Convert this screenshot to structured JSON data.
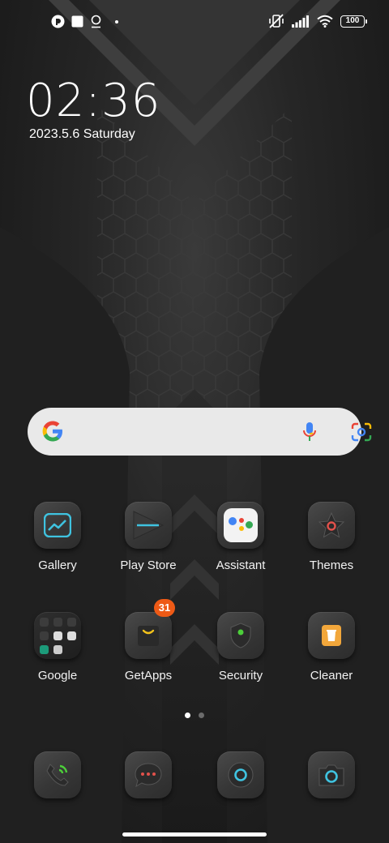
{
  "status_bar": {
    "battery_level": "100",
    "icons_left": [
      "app-notification-icon",
      "square-icon",
      "location-pin-icon",
      "dot-icon"
    ],
    "icons_right": [
      "mute-vibrate-icon",
      "signal-icon",
      "wifi-icon",
      "battery-icon"
    ]
  },
  "clock": {
    "time": "02:36",
    "date": "2023.5.6 Saturday"
  },
  "search": {
    "left_icon": "google-g-icon",
    "mic_icon": "mic-icon",
    "lens_icon": "lens-icon"
  },
  "apps_row1": [
    {
      "label": "Gallery",
      "icon": "gallery-icon"
    },
    {
      "label": "Play Store",
      "icon": "play-store-icon"
    },
    {
      "label": "Assistant",
      "icon": "assistant-icon"
    },
    {
      "label": "Themes",
      "icon": "themes-icon"
    }
  ],
  "apps_row2": [
    {
      "label": "Google",
      "icon": "google-folder-icon"
    },
    {
      "label": "GetApps",
      "icon": "getapps-icon",
      "badge": "31"
    },
    {
      "label": "Security",
      "icon": "security-icon"
    },
    {
      "label": "Cleaner",
      "icon": "cleaner-icon"
    }
  ],
  "page_indicator": {
    "pages": 2,
    "current": 1
  },
  "dock": [
    {
      "icon": "phone-icon"
    },
    {
      "icon": "messaging-icon"
    },
    {
      "icon": "browser-icon"
    },
    {
      "icon": "camera-icon"
    }
  ],
  "colors": {
    "accent_cyan": "#3fc3e0",
    "badge_orange": "#ee5a16",
    "green": "#4ccf3a"
  }
}
